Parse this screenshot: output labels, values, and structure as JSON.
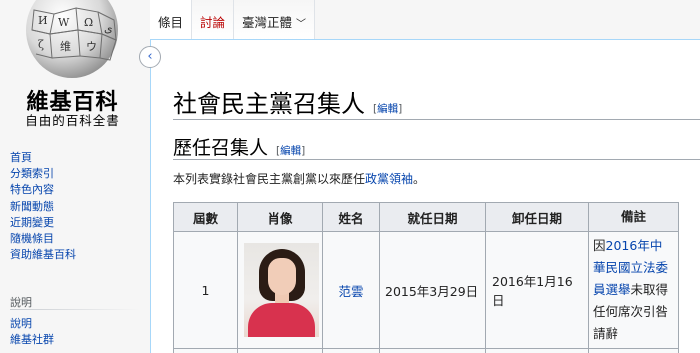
{
  "sidebar": {
    "logo_title": "維基百科",
    "logo_subtitle": "自由的百科全書",
    "nav_items": [
      "首頁",
      "分類索引",
      "特色內容",
      "新聞動態",
      "近期變更",
      "隨機條目",
      "資助維基百科"
    ],
    "section_title": "說明",
    "section_items": [
      "說明",
      "維基社群"
    ]
  },
  "tabs": {
    "article": "條目",
    "talk": "討論",
    "variant": "臺灣正體"
  },
  "article": {
    "title": "社會民主黨召集人",
    "title_edit": "編輯",
    "section_heading": "歷任召集人",
    "section_edit": "編輯",
    "intro_text": "本列表實錄社會民主黨創黨以來歷任",
    "intro_link": "政黨領袖",
    "intro_end": "。"
  },
  "table": {
    "headers": [
      "屆數",
      "肖像",
      "姓名",
      "就任日期",
      "卸任日期",
      "備註"
    ],
    "rows": [
      {
        "term": "1",
        "portrait_alt": "范雲肖像",
        "name": "范雲",
        "start": "2015年3月29日",
        "end": "2016年1月16日",
        "note_prefix": "因",
        "note_link": "2016年中華民國立法委員選舉",
        "note_suffix": "未取得任何席次引咎請辭"
      }
    ]
  },
  "colors": {
    "link": "#0645ad",
    "new_link": "#ba0000",
    "header_bg": "#eaecf0",
    "border": "#a2a9b1"
  }
}
